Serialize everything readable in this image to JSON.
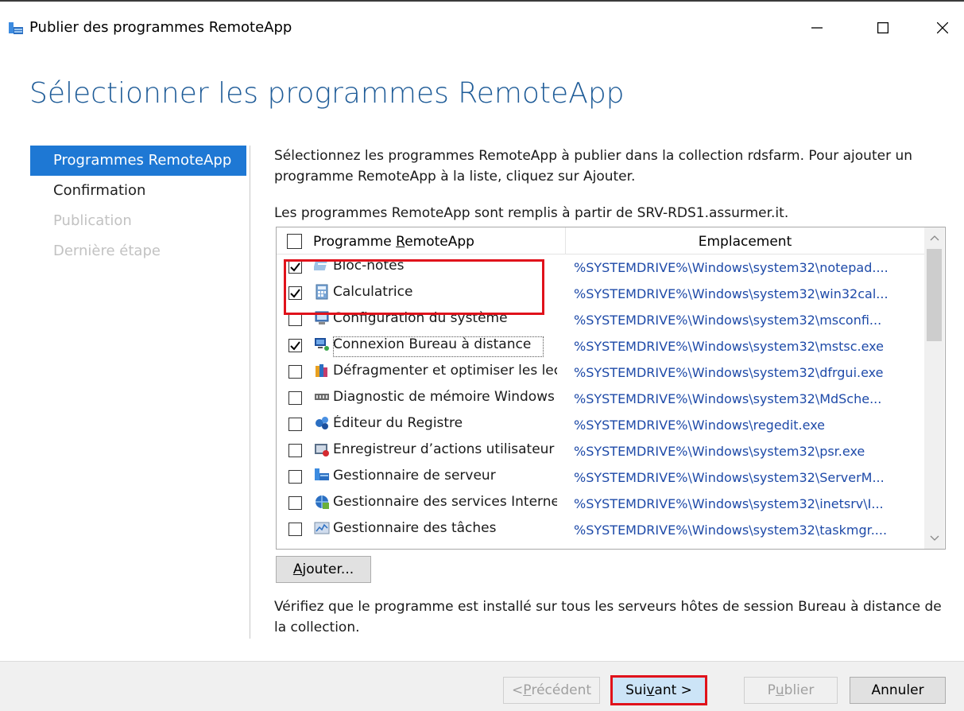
{
  "window": {
    "title": "Publier des programmes RemoteApp",
    "minimize_glyph": "—",
    "maximize_glyph": "☐",
    "close_glyph": "✕"
  },
  "heading": "Sélectionner les programmes RemoteApp",
  "nav": {
    "items": [
      {
        "label": "Programmes RemoteApp",
        "state": "active"
      },
      {
        "label": "Confirmation",
        "state": "normal"
      },
      {
        "label": "Publication",
        "state": "disabled"
      },
      {
        "label": "Dernière étape",
        "state": "disabled"
      }
    ]
  },
  "content": {
    "intro": "Sélectionnez les programmes RemoteApp à publier dans la collection rdsfarm. Pour ajouter un programme RemoteApp à la liste, cliquez sur Ajouter.",
    "source": "Les programmes RemoteApp sont remplis à partir de SRV-RDS1.assurmer.it.",
    "footnote": "Vérifiez que le programme est installé sur tous les serveurs hôtes de session Bureau à distance de la collection."
  },
  "list": {
    "col_program_prefix": "Programme ",
    "col_program_accel": "R",
    "col_program_suffix": "emoteApp",
    "col_location": "Emplacement",
    "rows": [
      {
        "name": "Bloc-notes",
        "location": "%SYSTEMDRIVE%\\Windows\\system32\\notepad....",
        "checked": true,
        "icon": "notepad-icon"
      },
      {
        "name": "Calculatrice",
        "location": "%SYSTEMDRIVE%\\Windows\\system32\\win32cal...",
        "checked": true,
        "icon": "calculator-icon"
      },
      {
        "name": "Configuration du système",
        "location": "%SYSTEMDRIVE%\\Windows\\system32\\msconfi...",
        "checked": false,
        "icon": "system-config-icon"
      },
      {
        "name": "Connexion Bureau à distance",
        "location": "%SYSTEMDRIVE%\\Windows\\system32\\mstsc.exe",
        "checked": true,
        "icon": "remote-desktop-icon",
        "focused": true
      },
      {
        "name": "Défragmenter et optimiser les lec",
        "location": "%SYSTEMDRIVE%\\Windows\\system32\\dfrgui.exe",
        "checked": false,
        "icon": "defrag-icon"
      },
      {
        "name": "Diagnostic de mémoire Windows",
        "location": "%SYSTEMDRIVE%\\Windows\\system32\\MdSche...",
        "checked": false,
        "icon": "memory-diagnostic-icon"
      },
      {
        "name": "Éditeur du Registre",
        "location": "%SYSTEMDRIVE%\\Windows\\regedit.exe",
        "checked": false,
        "icon": "registry-editor-icon"
      },
      {
        "name": "Enregistreur d’actions utilisateur",
        "location": "%SYSTEMDRIVE%\\Windows\\system32\\psr.exe",
        "checked": false,
        "icon": "steps-recorder-icon"
      },
      {
        "name": "Gestionnaire de serveur",
        "location": "%SYSTEMDRIVE%\\Windows\\system32\\ServerM...",
        "checked": false,
        "icon": "server-manager-icon"
      },
      {
        "name": "Gestionnaire des services Internet",
        "location": "%SYSTEMDRIVE%\\Windows\\system32\\inetsrv\\I...",
        "checked": false,
        "icon": "iis-manager-icon"
      },
      {
        "name": "Gestionnaire des tâches",
        "location": "%SYSTEMDRIVE%\\Windows\\system32\\taskmgr....",
        "checked": false,
        "icon": "task-manager-icon"
      }
    ]
  },
  "buttons": {
    "add_accel": "A",
    "add_rest": "jouter...",
    "prev_prefix": "< ",
    "prev_accel": "P",
    "prev_rest": "récédent",
    "next_prefix": "Sui",
    "next_accel": "v",
    "next_rest": "ant >",
    "publish_prefix": "P",
    "publish_accel": "u",
    "publish_rest": "blier",
    "cancel": "Annuler"
  },
  "colors": {
    "heading": "#1f5c98",
    "nav_active": "#1e78d4",
    "location_text": "#1e4aa8",
    "annotation": "#e0121b"
  }
}
